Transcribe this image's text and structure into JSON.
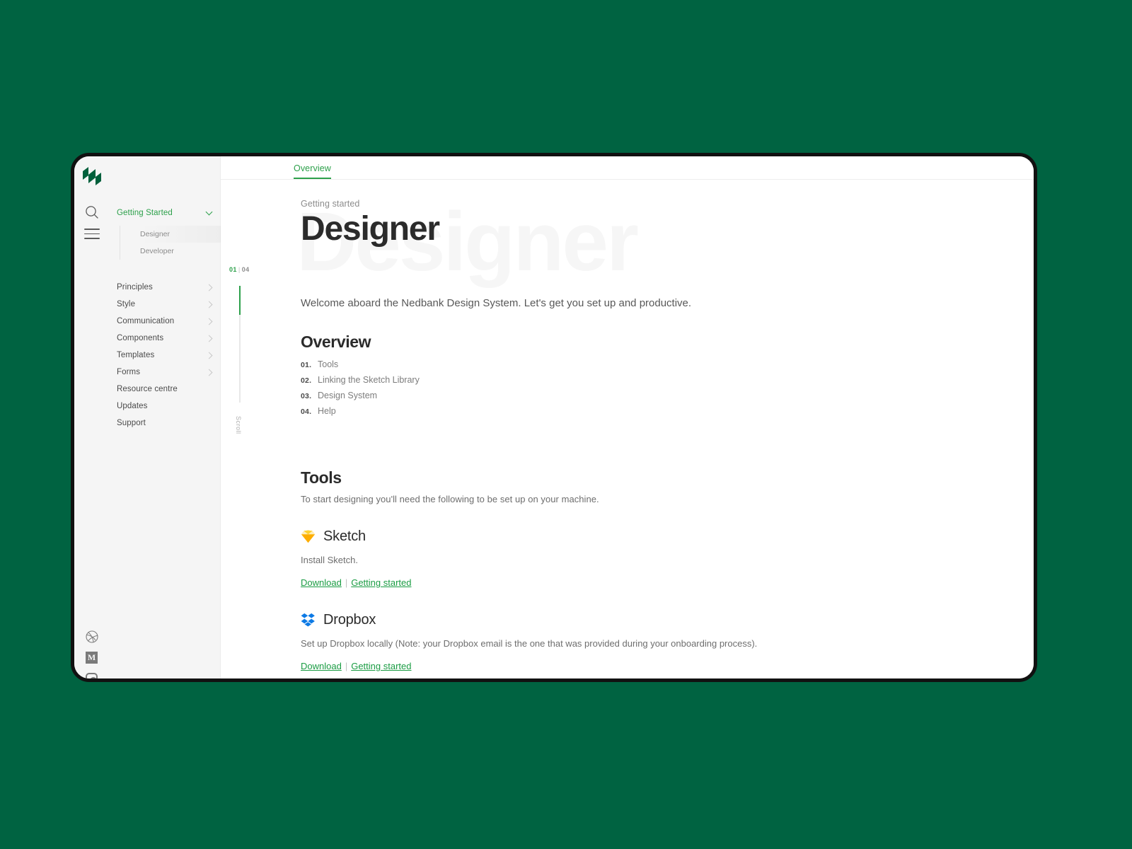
{
  "brand": {
    "logo_name": "nedbank-logo",
    "logo_color": "#00603c",
    "accent_color": "#2ca04a",
    "page_background": "#006341",
    "sidebar_background": "#f5f5f5"
  },
  "rail": {
    "search_icon": "search-icon",
    "menu_icon": "hamburger-menu-icon",
    "social": [
      {
        "name": "dribbble-icon",
        "label": "Dribbble"
      },
      {
        "name": "medium-icon",
        "label": "M"
      },
      {
        "name": "instagram-icon",
        "label": "Instagram"
      }
    ]
  },
  "sidebar": {
    "active_group": {
      "label": "Getting Started",
      "expanded": true,
      "chevron": "chevron-down-icon",
      "children": [
        {
          "label": "Designer",
          "selected": true
        },
        {
          "label": "Developer",
          "selected": false
        }
      ]
    },
    "items": [
      {
        "label": "Principles",
        "chevron": "chevron-right-icon",
        "has_children": true
      },
      {
        "label": "Style",
        "chevron": "chevron-right-icon",
        "has_children": true
      },
      {
        "label": "Communication",
        "chevron": "chevron-right-icon",
        "has_children": true
      },
      {
        "label": "Components",
        "chevron": "chevron-right-icon",
        "has_children": true
      },
      {
        "label": "Templates",
        "chevron": "chevron-right-icon",
        "has_children": true
      },
      {
        "label": "Forms",
        "chevron": "chevron-right-icon",
        "has_children": true
      },
      {
        "label": "Resource centre",
        "chevron": "",
        "has_children": false
      },
      {
        "label": "Updates",
        "chevron": "",
        "has_children": false
      },
      {
        "label": "Support",
        "chevron": "",
        "has_children": false
      }
    ]
  },
  "tabs": [
    {
      "label": "Overview",
      "active": true
    }
  ],
  "scroll": {
    "current": "01",
    "separator": "|",
    "total": "04",
    "label": "Scroll",
    "progress_percent": 25
  },
  "article": {
    "watermark": "Designer",
    "eyebrow": "Getting started",
    "title": "Designer",
    "lede": "Welcome aboard the Nedbank Design System. Let's get you set up and productive.",
    "overview": {
      "heading": "Overview",
      "items": [
        {
          "num": "01.",
          "label": "Tools"
        },
        {
          "num": "02.",
          "label": "Linking the Sketch Library"
        },
        {
          "num": "03.",
          "label": "Design System"
        },
        {
          "num": "04.",
          "label": "Help"
        }
      ]
    },
    "tools": {
      "heading": "Tools",
      "description": "To start designing you'll need the following to be set up on your machine.",
      "entries": [
        {
          "icon": "sketch-icon",
          "icon_color": "#fdb300",
          "name": "Sketch",
          "description": "Install Sketch.",
          "links": [
            {
              "label": "Download"
            },
            {
              "label": "Getting started"
            }
          ],
          "link_separator": "|"
        },
        {
          "icon": "dropbox-icon",
          "icon_color": "#0d7ae5",
          "name": "Dropbox",
          "description": "Set up Dropbox locally (Note: your Dropbox email is the one that was provided during your onboarding process).",
          "links": [
            {
              "label": "Download"
            },
            {
              "label": "Getting started"
            }
          ],
          "link_separator": "|"
        }
      ]
    }
  }
}
